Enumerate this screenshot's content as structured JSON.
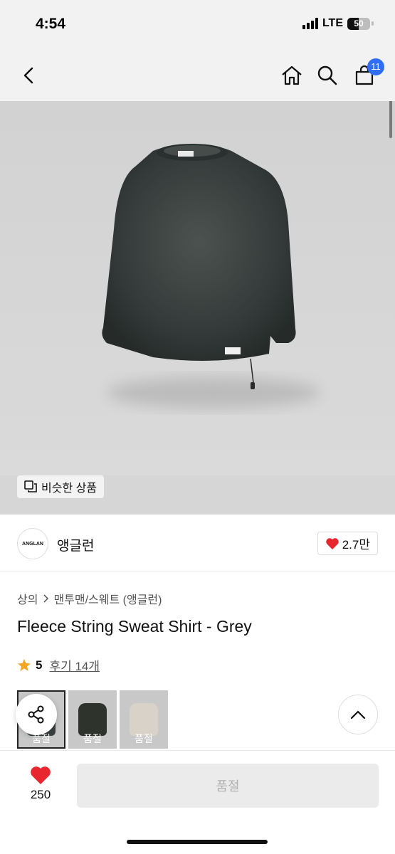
{
  "status_bar": {
    "time": "4:54",
    "network": "LTE",
    "battery_percent": "50",
    "battery_level": 0.5
  },
  "nav": {
    "cart_count": "11",
    "icons": [
      "back-icon",
      "home-icon",
      "search-icon",
      "cart-icon"
    ]
  },
  "image": {
    "similar_label": "비슷한 상품"
  },
  "brand": {
    "logo_text": "ANGLAN",
    "name": "앵글런",
    "likes": "2.7만"
  },
  "breadcrumb": {
    "category": "상의",
    "subcategory": "맨투맨/스웨트 (앵글런)"
  },
  "product": {
    "title": "Fleece String Sweat Shirt - Grey",
    "rating": "5",
    "review_label": "후기 14개"
  },
  "variants": [
    {
      "status": "품절",
      "color": "#3a4040"
    },
    {
      "status": "품절",
      "color": "#2e332c"
    },
    {
      "status": "품절",
      "color": "#d8d2c8"
    }
  ],
  "bottom_bar": {
    "wish_count": "250",
    "buy_label": "품절"
  },
  "colors": {
    "accent_blue": "#2f6ef5",
    "heart_red": "#e8262f",
    "star_orange": "#f5a623"
  }
}
